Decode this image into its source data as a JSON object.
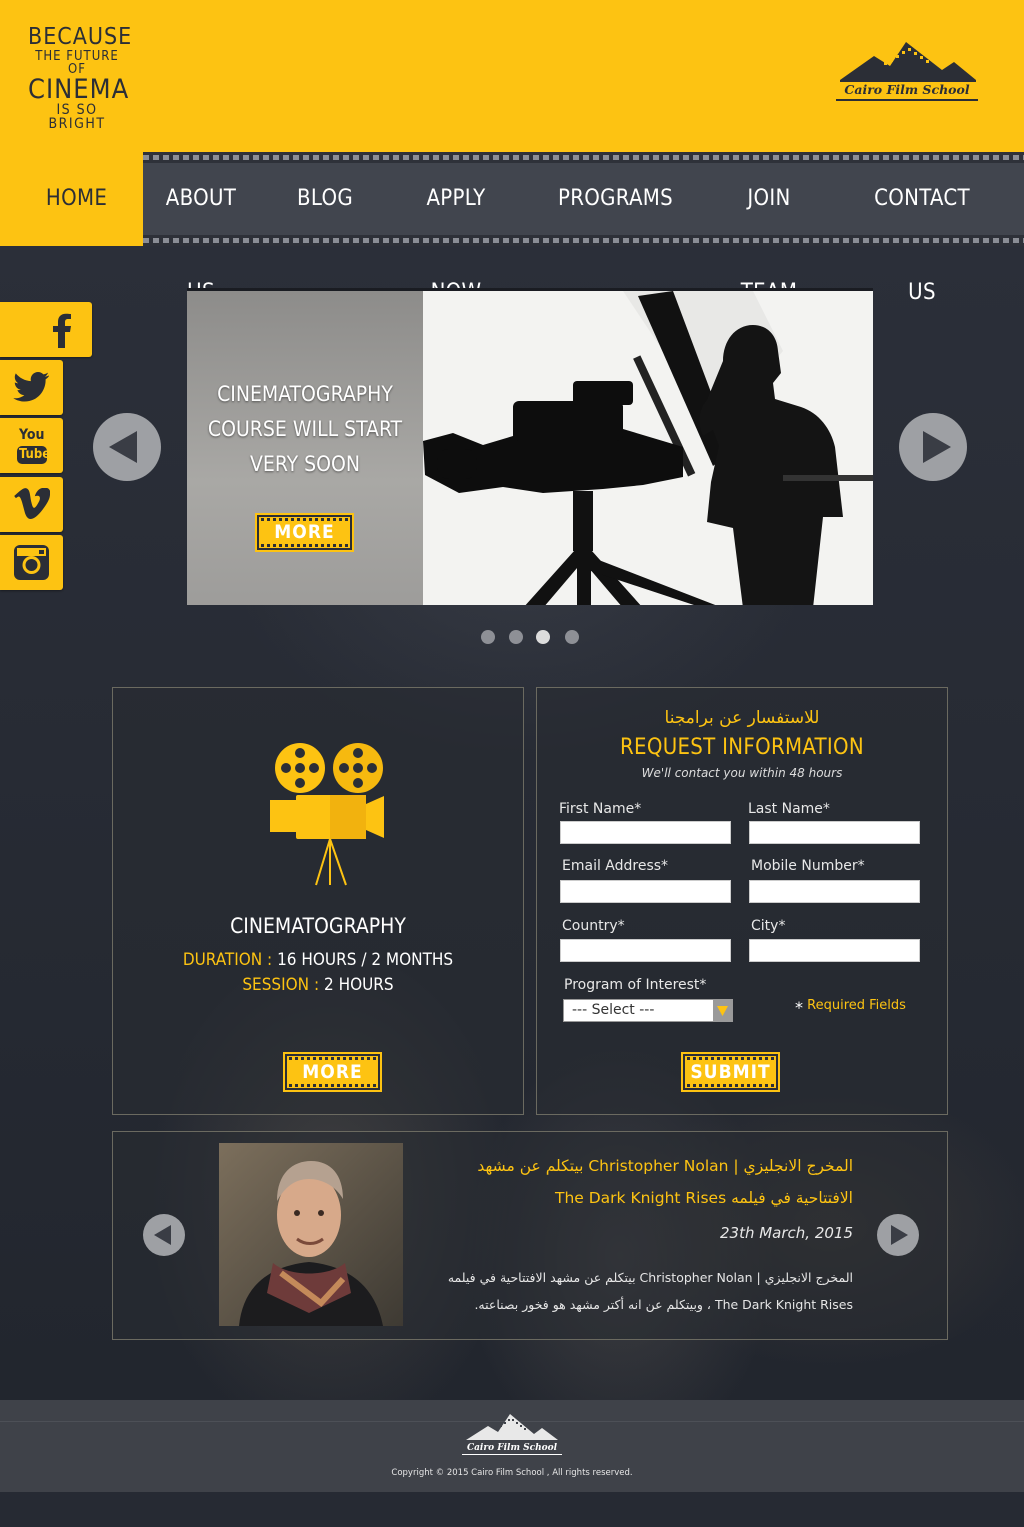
{
  "header": {
    "tagline": [
      "BECAUSE",
      "THE FUTURE OF",
      "CINEMA",
      "IS SO BRIGHT"
    ],
    "logo_text": "Cairo Film School"
  },
  "nav": {
    "items": [
      {
        "label": "HOME",
        "active": true
      },
      {
        "label": "ABOUT US"
      },
      {
        "label": "BLOG"
      },
      {
        "label": "APPLY NOW"
      },
      {
        "label": "PROGRAMS"
      },
      {
        "label": "JOIN TEAM"
      },
      {
        "label": "CONTACT US"
      }
    ]
  },
  "social": [
    {
      "icon": "facebook-icon"
    },
    {
      "icon": "twitter-icon"
    },
    {
      "icon": "youtube-icon",
      "text": [
        "You",
        "Tube"
      ]
    },
    {
      "icon": "vimeo-icon"
    },
    {
      "icon": "instagram-icon"
    }
  ],
  "slider": {
    "title_lines": [
      "CINEMATOGRAPHY",
      "COURSE WILL START",
      "VERY SOON"
    ],
    "more_label": "MORE",
    "dot_count": 4,
    "active_dot": 3
  },
  "course": {
    "name": "CINEMATOGRAPHY",
    "duration_label": "DURATION :",
    "duration_value": "16 HOURS / 2 MONTHS",
    "session_label": "SESSION :",
    "session_value": "2 HOURS",
    "more_label": "MORE"
  },
  "request": {
    "arabic_title": "للاستفسار عن برامجنا",
    "title": "REQUEST INFORMATION",
    "subtitle": "We'll contact you within 48 hours",
    "fields": {
      "first_name": "First Name*",
      "last_name": "Last Name*",
      "email": "Email Address*",
      "mobile": "Mobile Number*",
      "country": "Country*",
      "city": "City*",
      "program": "Program of Interest*"
    },
    "select_value": "--- Select ---",
    "required_note": "Required Fields",
    "required_star": "*",
    "submit_label": "SUBMIT"
  },
  "news": {
    "title_line1": "المخرج الانجليزي | Christopher Nolan بيتكلم عن مشهد",
    "title_line2": "الافتتاحية في فيلمه The Dark Knight Rises",
    "date": "23th March, 2015",
    "body_line1": "المخرج الانجليزي | Christopher Nolan بيتكلم عن مشهد الافتتاحية في فيلمه",
    "body_line2": "The Dark Knight Rises ، وبيتكلم عن انه أكتر مشهد هو فخور بصناعته."
  },
  "footer": {
    "logo_text": "Cairo Film School",
    "copyright": "Copyright © 2015 Cairo Film School , All rights reserved."
  },
  "colors": {
    "accent": "#fdc312",
    "nav_bg": "#41454e",
    "page_bg": "#262a33",
    "footer_bg": "#3f4249"
  }
}
